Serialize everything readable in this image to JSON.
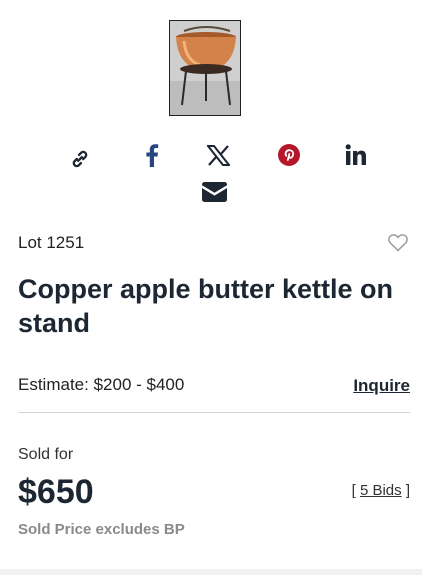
{
  "item": {
    "thumbnail_alt": "Copper apple butter kettle on stand",
    "lot": "Lot 1251",
    "title": "Copper apple butter kettle on stand",
    "estimate": "Estimate: $200 - $400",
    "inquire_label": "Inquire"
  },
  "share": {
    "icons": [
      "link-icon",
      "facebook-icon",
      "x-icon",
      "pinterest-icon",
      "linkedin-icon",
      "email-icon"
    ],
    "colors": {
      "default": "#1d2633",
      "facebook": "#27467f",
      "pinterest": "#b5172a"
    }
  },
  "sale": {
    "sold_label": "Sold for",
    "price": "$650",
    "bids_open": "[",
    "bids_label": "5 Bids",
    "bids_close": "]",
    "bp_note": "Sold Price excludes BP"
  }
}
